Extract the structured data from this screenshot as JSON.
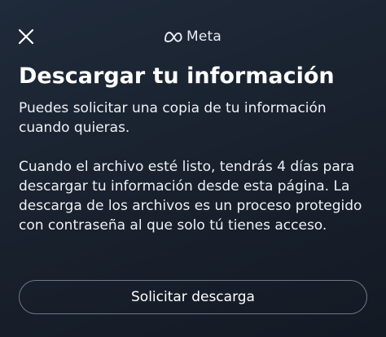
{
  "header": {
    "close_icon": "close-icon",
    "brand_logo_icon": "meta-logo-icon",
    "brand_name": "Meta"
  },
  "main": {
    "title": "Descargar tu información",
    "paragraph_1": "Puedes solicitar una copia de tu información cuando quieras.",
    "paragraph_2": "Cuando el archivo esté listo, tendrás 4 días para descargar tu información desde esta página. La descarga de los archivos es un proceso protegido con contraseña al que solo tú tienes acceso.",
    "request_download_label": "Solicitar descarga"
  },
  "colors": {
    "background": "#18202c",
    "text": "#ffffff",
    "button_border": "#6e7886"
  }
}
